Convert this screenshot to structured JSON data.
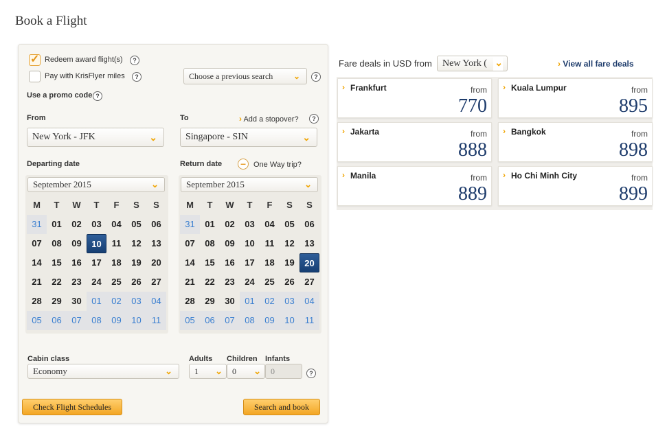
{
  "page": {
    "title": "Book a Flight"
  },
  "booking": {
    "redeem_label": "Redeem award flight(s)",
    "redeem_checked": true,
    "pay_krisflyer_label": "Pay with KrisFlyer miles",
    "pay_krisflyer_checked": false,
    "previous_search_label": "Choose a previous search",
    "promo_label": "Use a promo code",
    "help_glyph": "?",
    "from_label": "From",
    "from_value": "New York - JFK",
    "to_label": "To",
    "to_value": "Singapore - SIN",
    "stopover_label": "Add a stopover?",
    "departing_label": "Departing date",
    "return_label": "Return date",
    "one_way_label": "One Way trip?",
    "depart_month": "September 2015",
    "return_month": "September 2015",
    "weekdays": [
      "M",
      "T",
      "W",
      "T",
      "F",
      "S",
      "S"
    ],
    "calendar_days": [
      [
        "31",
        "01",
        "02",
        "03",
        "04",
        "05",
        "06"
      ],
      [
        "07",
        "08",
        "09",
        "10",
        "11",
        "12",
        "13"
      ],
      [
        "14",
        "15",
        "16",
        "17",
        "18",
        "19",
        "20"
      ],
      [
        "21",
        "22",
        "23",
        "24",
        "25",
        "26",
        "27"
      ],
      [
        "28",
        "29",
        "30",
        "01",
        "02",
        "03",
        "04"
      ],
      [
        "05",
        "06",
        "07",
        "08",
        "09",
        "10",
        "11"
      ]
    ],
    "depart_selected": "10",
    "return_selected": "20",
    "cabin_label": "Cabin class",
    "cabin_value": "Economy",
    "adults_label": "Adults",
    "adults_value": "1",
    "children_label": "Children",
    "children_value": "0",
    "infants_label": "Infants",
    "infants_value": "0",
    "schedules_button": "Check Flight Schedules",
    "search_button": "Search and book"
  },
  "fares": {
    "heading": "Fare deals in USD from",
    "origin_value": "New York (",
    "view_all": "View all fare deals",
    "from_word": "from",
    "deals": [
      {
        "city": "Frankfurt",
        "price": "770"
      },
      {
        "city": "Kuala Lumpur",
        "price": "895"
      },
      {
        "city": "Jakarta",
        "price": "888"
      },
      {
        "city": "Bangkok",
        "price": "898"
      },
      {
        "city": "Manila",
        "price": "889"
      },
      {
        "city": "Ho Chi Minh City",
        "price": "899"
      }
    ]
  },
  "colors": {
    "accent": "#f0a400",
    "selected_day": "#1d4a80",
    "price": "#1d3b6b"
  }
}
